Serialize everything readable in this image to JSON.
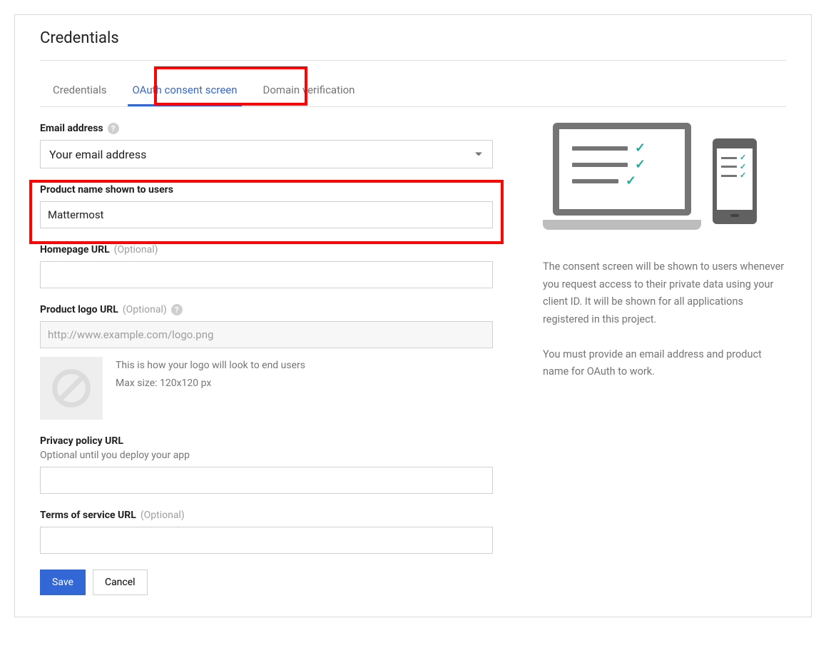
{
  "page": {
    "title": "Credentials"
  },
  "tabs": {
    "credentials": "Credentials",
    "oauth": "OAuth consent screen",
    "domain": "Domain verification"
  },
  "form": {
    "email": {
      "label": "Email address",
      "value": "Your email address"
    },
    "product_name": {
      "label": "Product name shown to users",
      "value": "Mattermost"
    },
    "homepage": {
      "label": "Homepage URL",
      "optional": "(Optional)",
      "value": ""
    },
    "logo_url": {
      "label": "Product logo URL",
      "optional": "(Optional)",
      "placeholder": "http://www.example.com/logo.png",
      "hint1": "This is how your logo will look to end users",
      "hint2": "Max size: 120x120 px"
    },
    "privacy": {
      "label": "Privacy policy URL",
      "sublabel": "Optional until you deploy your app",
      "value": ""
    },
    "tos": {
      "label": "Terms of service URL",
      "optional": "(Optional)",
      "value": ""
    }
  },
  "buttons": {
    "save": "Save",
    "cancel": "Cancel"
  },
  "info": {
    "p1": "The consent screen will be shown to users whenever you request access to their private data using your client ID. It will be shown for all applications registered in this project.",
    "p2": "You must provide an email address and product name for OAuth to work."
  }
}
